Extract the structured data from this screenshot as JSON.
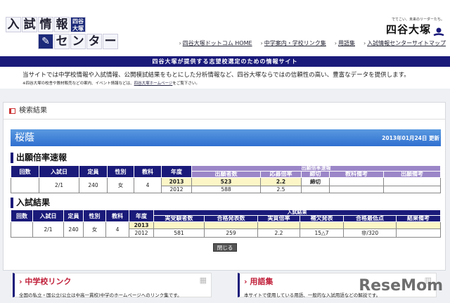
{
  "logo": {
    "chars": [
      "入",
      "試",
      "情",
      "報"
    ],
    "badge": "四谷大塚",
    "chars2": [
      "セ",
      "ン",
      "タ",
      "ー"
    ]
  },
  "brand": {
    "tagline": "でてこい、未来のリーダーたち。",
    "name": "四谷大塚"
  },
  "nav": [
    "四谷大塚ドットコム HOME",
    "中学案内・学校リンク集",
    "用語集",
    "入試情報センターサイトマップ"
  ],
  "banner": "四谷大塚が提供する志望校選定のための情報サイト",
  "intro": "当サイトでは中学校情報や入試情報、公開模試結果をもとにした分析情報など、四谷大塚ならではの信頼性の高い、豊富なデータを提供します。",
  "note": {
    "pre": "※四谷大塚の校舎や教材販売などの案内、イベント情報などは、",
    "link": "四谷大塚ホームページ",
    "post": "をご覧下さい。"
  },
  "panel": {
    "title": "検索結果",
    "school": "桜蔭",
    "updated": "2013年01月24日 更新"
  },
  "t1": {
    "title": "出願倍率速報",
    "headers": [
      "回数",
      "入試日",
      "定員",
      "性別",
      "教科",
      "年度"
    ],
    "group": "出願倍率速報",
    "sub": [
      "出願者数",
      "応募倍率",
      "締切",
      "教科備考",
      "出願備考"
    ],
    "common": [
      "",
      "2/1",
      "240",
      "女",
      "4"
    ],
    "rows": [
      [
        "2013",
        "523",
        "2.2",
        "締切",
        "",
        ""
      ],
      [
        "2012",
        "588",
        "2.5",
        "",
        "",
        ""
      ]
    ]
  },
  "t2": {
    "title": "入試結果",
    "headers": [
      "回数",
      "入試日",
      "定員",
      "性別",
      "教科",
      "年度"
    ],
    "group": "入試結果",
    "sub": [
      "実受験者数",
      "合格発表数",
      "実質倍率",
      "補欠発表",
      "合格最低点",
      "結果備考"
    ],
    "common": [
      "",
      "2/1",
      "240",
      "女",
      "4"
    ],
    "rows": [
      [
        "2013",
        "",
        "",
        "",
        "",
        "",
        ""
      ],
      [
        "2012",
        "581",
        "259",
        "2.2",
        "15△7",
        "非/320",
        ""
      ]
    ]
  },
  "close": "閉じる",
  "boxes": [
    {
      "title": "中学校リンク",
      "desc": "全国の私立・国公立(公立は中高一貫校)中学のホームページへのリンク集です。"
    },
    {
      "title": "用語集",
      "desc": "本サイトで使用している用語、一般的な入試用語などの解説です。"
    }
  ],
  "watermark": "ReseMom"
}
